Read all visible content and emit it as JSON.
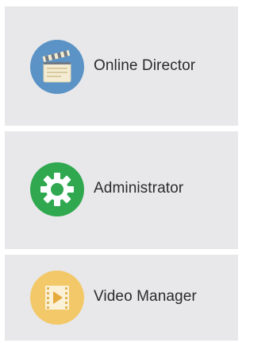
{
  "menu": {
    "items": [
      {
        "label": "Online Director",
        "icon": "clapperboard-icon",
        "color": "#5b93c6"
      },
      {
        "label": "Administrator",
        "icon": "gear-icon",
        "color": "#2fa84f"
      },
      {
        "label": "Video Manager",
        "icon": "film-play-icon",
        "color": "#f2c869"
      }
    ]
  }
}
